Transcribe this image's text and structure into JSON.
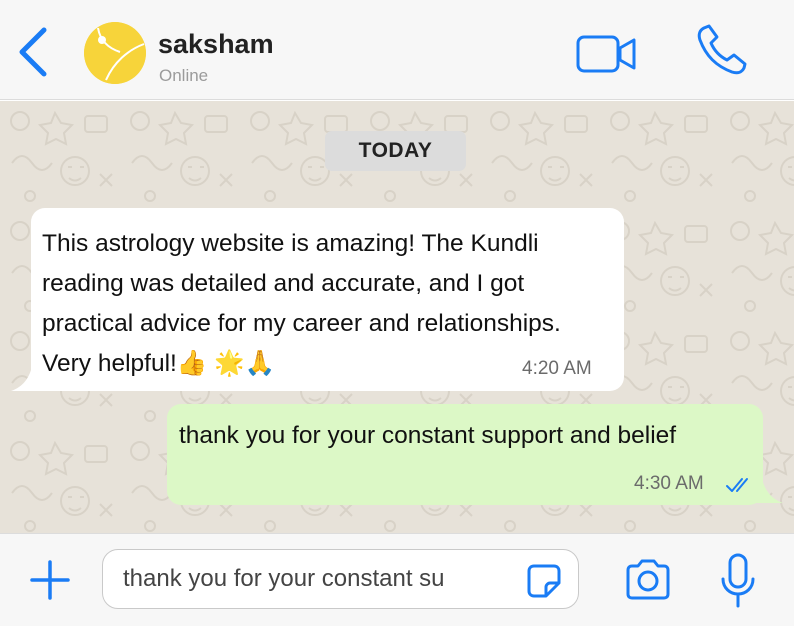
{
  "header": {
    "contact_name": "saksham",
    "contact_status": "Online",
    "icons": {
      "back": "chevron-left-icon",
      "video": "video-camera-icon",
      "call": "phone-icon"
    }
  },
  "chat": {
    "date_label": "TODAY",
    "messages": [
      {
        "direction": "incoming",
        "text": "This astrology website is amazing! The Kundli reading was detailed and accurate, and I got practical advice for my career and relationships. Very helpful!👍 🌟🙏",
        "time": "4:20 AM"
      },
      {
        "direction": "outgoing",
        "text": "thank you for your constant support and belief",
        "time": "4:30 AM",
        "status": "read"
      }
    ]
  },
  "composer": {
    "input_value": "thank you for your constant su",
    "icons": {
      "add": "plus-icon",
      "sticker": "sticker-icon",
      "camera": "camera-icon",
      "mic": "microphone-icon"
    }
  },
  "colors": {
    "accent": "#1a7cf5",
    "incoming_bubble": "#ffffff",
    "outgoing_bubble": "#dcf8c6",
    "chat_background": "#e7e2d9",
    "avatar": "#f7d43a"
  }
}
